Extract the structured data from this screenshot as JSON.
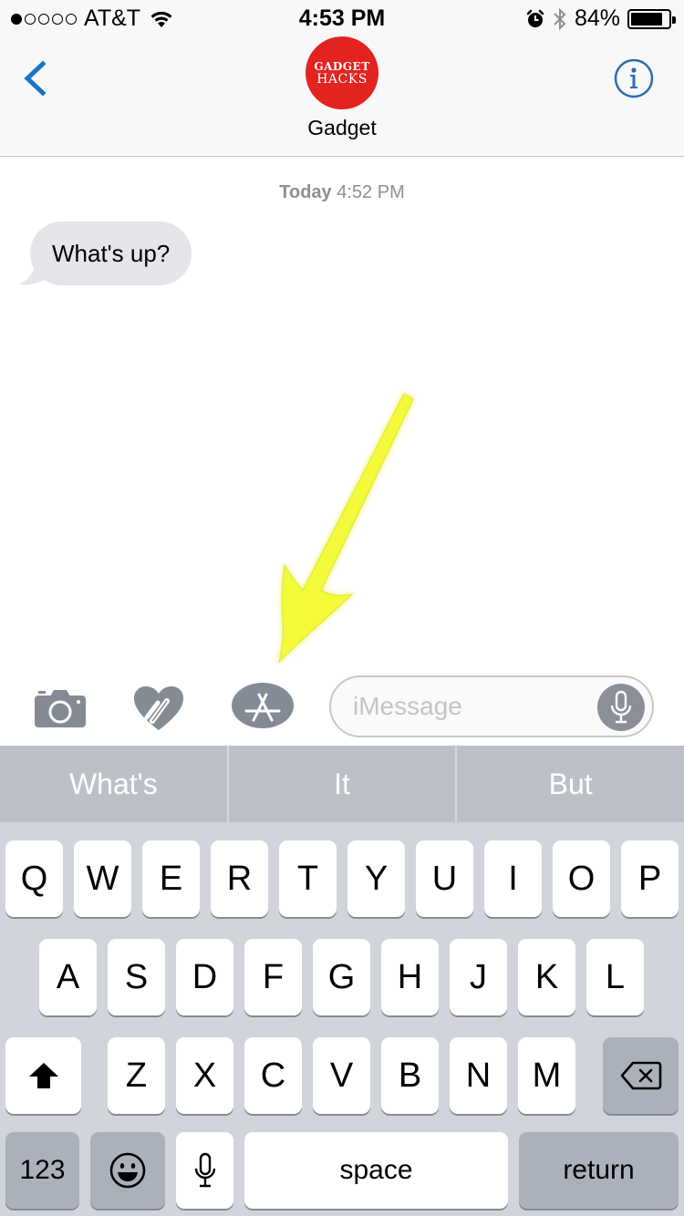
{
  "status_bar": {
    "signal_bars_filled": 1,
    "signal_bars_total": 5,
    "carrier": "AT&T",
    "time": "4:53 PM",
    "battery_percent": "84%",
    "battery_level": 0.84,
    "icons": [
      "signal-dots-icon",
      "wifi-icon",
      "alarm-icon",
      "bluetooth-icon",
      "battery-icon"
    ]
  },
  "header": {
    "back_icon": "chevron-left-icon",
    "avatar_line1": "GADGET",
    "avatar_line2": "HACKS",
    "contact_name": "Gadget",
    "info_icon": "info-icon",
    "accent_color": "#1a74c9",
    "avatar_color": "#e2231f"
  },
  "conversation": {
    "timestamp_day": "Today",
    "timestamp_time": "4:52 PM",
    "messages": [
      {
        "direction": "incoming",
        "text": "What's up?"
      }
    ]
  },
  "annotation": {
    "type": "arrow",
    "color": "#f3fb3a",
    "points_to": "app-store-button"
  },
  "input_bar": {
    "camera_icon": "camera-icon",
    "digital_touch_icon": "heart-digital-touch-icon",
    "app_store_icon": "app-store-icon",
    "message_placeholder": "iMessage",
    "message_value": "",
    "dictation_icon": "microphone-icon"
  },
  "keyboard": {
    "suggestions": [
      "What's",
      "It",
      "But"
    ],
    "row1": [
      "Q",
      "W",
      "E",
      "R",
      "T",
      "Y",
      "U",
      "I",
      "O",
      "P"
    ],
    "row2": [
      "A",
      "S",
      "D",
      "F",
      "G",
      "H",
      "J",
      "K",
      "L"
    ],
    "row3": [
      "Z",
      "X",
      "C",
      "V",
      "B",
      "N",
      "M"
    ],
    "numbers_label": "123",
    "space_label": "space",
    "return_label": "return",
    "shift_icon": "shift-arrow-icon",
    "delete_icon": "backspace-icon",
    "emoji_icon": "emoji-icon",
    "mic_icon": "microphone-icon"
  }
}
